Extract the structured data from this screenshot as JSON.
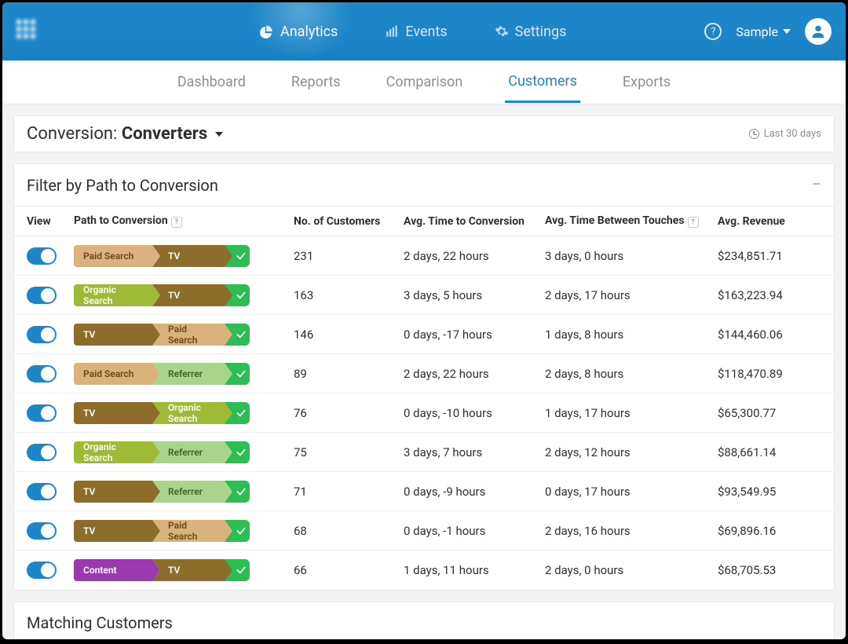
{
  "topnav": {
    "analytics": "Analytics",
    "events": "Events",
    "settings": "Settings",
    "sample": "Sample"
  },
  "subnav": {
    "dashboard": "Dashboard",
    "reports": "Reports",
    "comparison": "Comparison",
    "customers": "Customers",
    "exports": "Exports"
  },
  "conversion": {
    "label": "Conversion: ",
    "value": "Converters",
    "time_range": "Last 30 days"
  },
  "filter_panel": {
    "title": "Filter by Path to Conversion"
  },
  "columns": {
    "view": "View",
    "path": "Path to Conversion",
    "customers": "No. of Customers",
    "avg_time": "Avg. Time to Conversion",
    "avg_between": "Avg. Time Between Touches",
    "revenue": "Avg. Revenue"
  },
  "rows": [
    {
      "path": [
        {
          "label": "Paid Search",
          "cls": "seg-paid seg-fixed"
        },
        {
          "label": "TV",
          "cls": "seg-tv"
        }
      ],
      "customers": "231",
      "avg_time": "2 days, 22 hours",
      "avg_between": "3 days, 0 hours",
      "revenue": "$234,851.71"
    },
    {
      "path": [
        {
          "label": "Organic Search",
          "cls": "seg-org seg-fixed"
        },
        {
          "label": "TV",
          "cls": "seg-tv"
        }
      ],
      "customers": "163",
      "avg_time": "3 days, 5 hours",
      "avg_between": "2 days, 17 hours",
      "revenue": "$163,223.94"
    },
    {
      "path": [
        {
          "label": "TV",
          "cls": "seg-tv seg-fixed"
        },
        {
          "label": "Paid Search",
          "cls": "seg-paidnarrow"
        }
      ],
      "customers": "146",
      "avg_time": "0 days, -17 hours",
      "avg_between": "1 days, 8 hours",
      "revenue": "$144,460.06"
    },
    {
      "path": [
        {
          "label": "Paid Search",
          "cls": "seg-paid seg-fixed"
        },
        {
          "label": "Referrer",
          "cls": "seg-ref"
        }
      ],
      "customers": "89",
      "avg_time": "2 days, 22 hours",
      "avg_between": "2 days, 8 hours",
      "revenue": "$118,470.89"
    },
    {
      "path": [
        {
          "label": "TV",
          "cls": "seg-tv seg-fixed"
        },
        {
          "label": "Organic Search",
          "cls": "seg-orgwide"
        }
      ],
      "customers": "76",
      "avg_time": "0 days, -10 hours",
      "avg_between": "1 days, 17 hours",
      "revenue": "$65,300.77"
    },
    {
      "path": [
        {
          "label": "Organic Search",
          "cls": "seg-org seg-fixed"
        },
        {
          "label": "Referrer",
          "cls": "seg-ref"
        }
      ],
      "customers": "75",
      "avg_time": "3 days, 7 hours",
      "avg_between": "2 days, 12 hours",
      "revenue": "$88,661.14"
    },
    {
      "path": [
        {
          "label": "TV",
          "cls": "seg-tv seg-fixed"
        },
        {
          "label": "Referrer",
          "cls": "seg-ref"
        }
      ],
      "customers": "71",
      "avg_time": "0 days, -9 hours",
      "avg_between": "0 days, 17 hours",
      "revenue": "$93,549.95"
    },
    {
      "path": [
        {
          "label": "TV",
          "cls": "seg-tv seg-fixed"
        },
        {
          "label": "Paid Search",
          "cls": "seg-paidnarrow"
        }
      ],
      "customers": "68",
      "avg_time": "0 days, -1 hours",
      "avg_between": "2 days, 16 hours",
      "revenue": "$69,896.16"
    },
    {
      "path": [
        {
          "label": "Content",
          "cls": "seg-content seg-fixed"
        },
        {
          "label": "TV",
          "cls": "seg-tv"
        }
      ],
      "customers": "66",
      "avg_time": "1 days, 11 hours",
      "avg_between": "2 days, 0 hours",
      "revenue": "$68,705.53"
    }
  ],
  "matching": {
    "title": "Matching Customers"
  }
}
